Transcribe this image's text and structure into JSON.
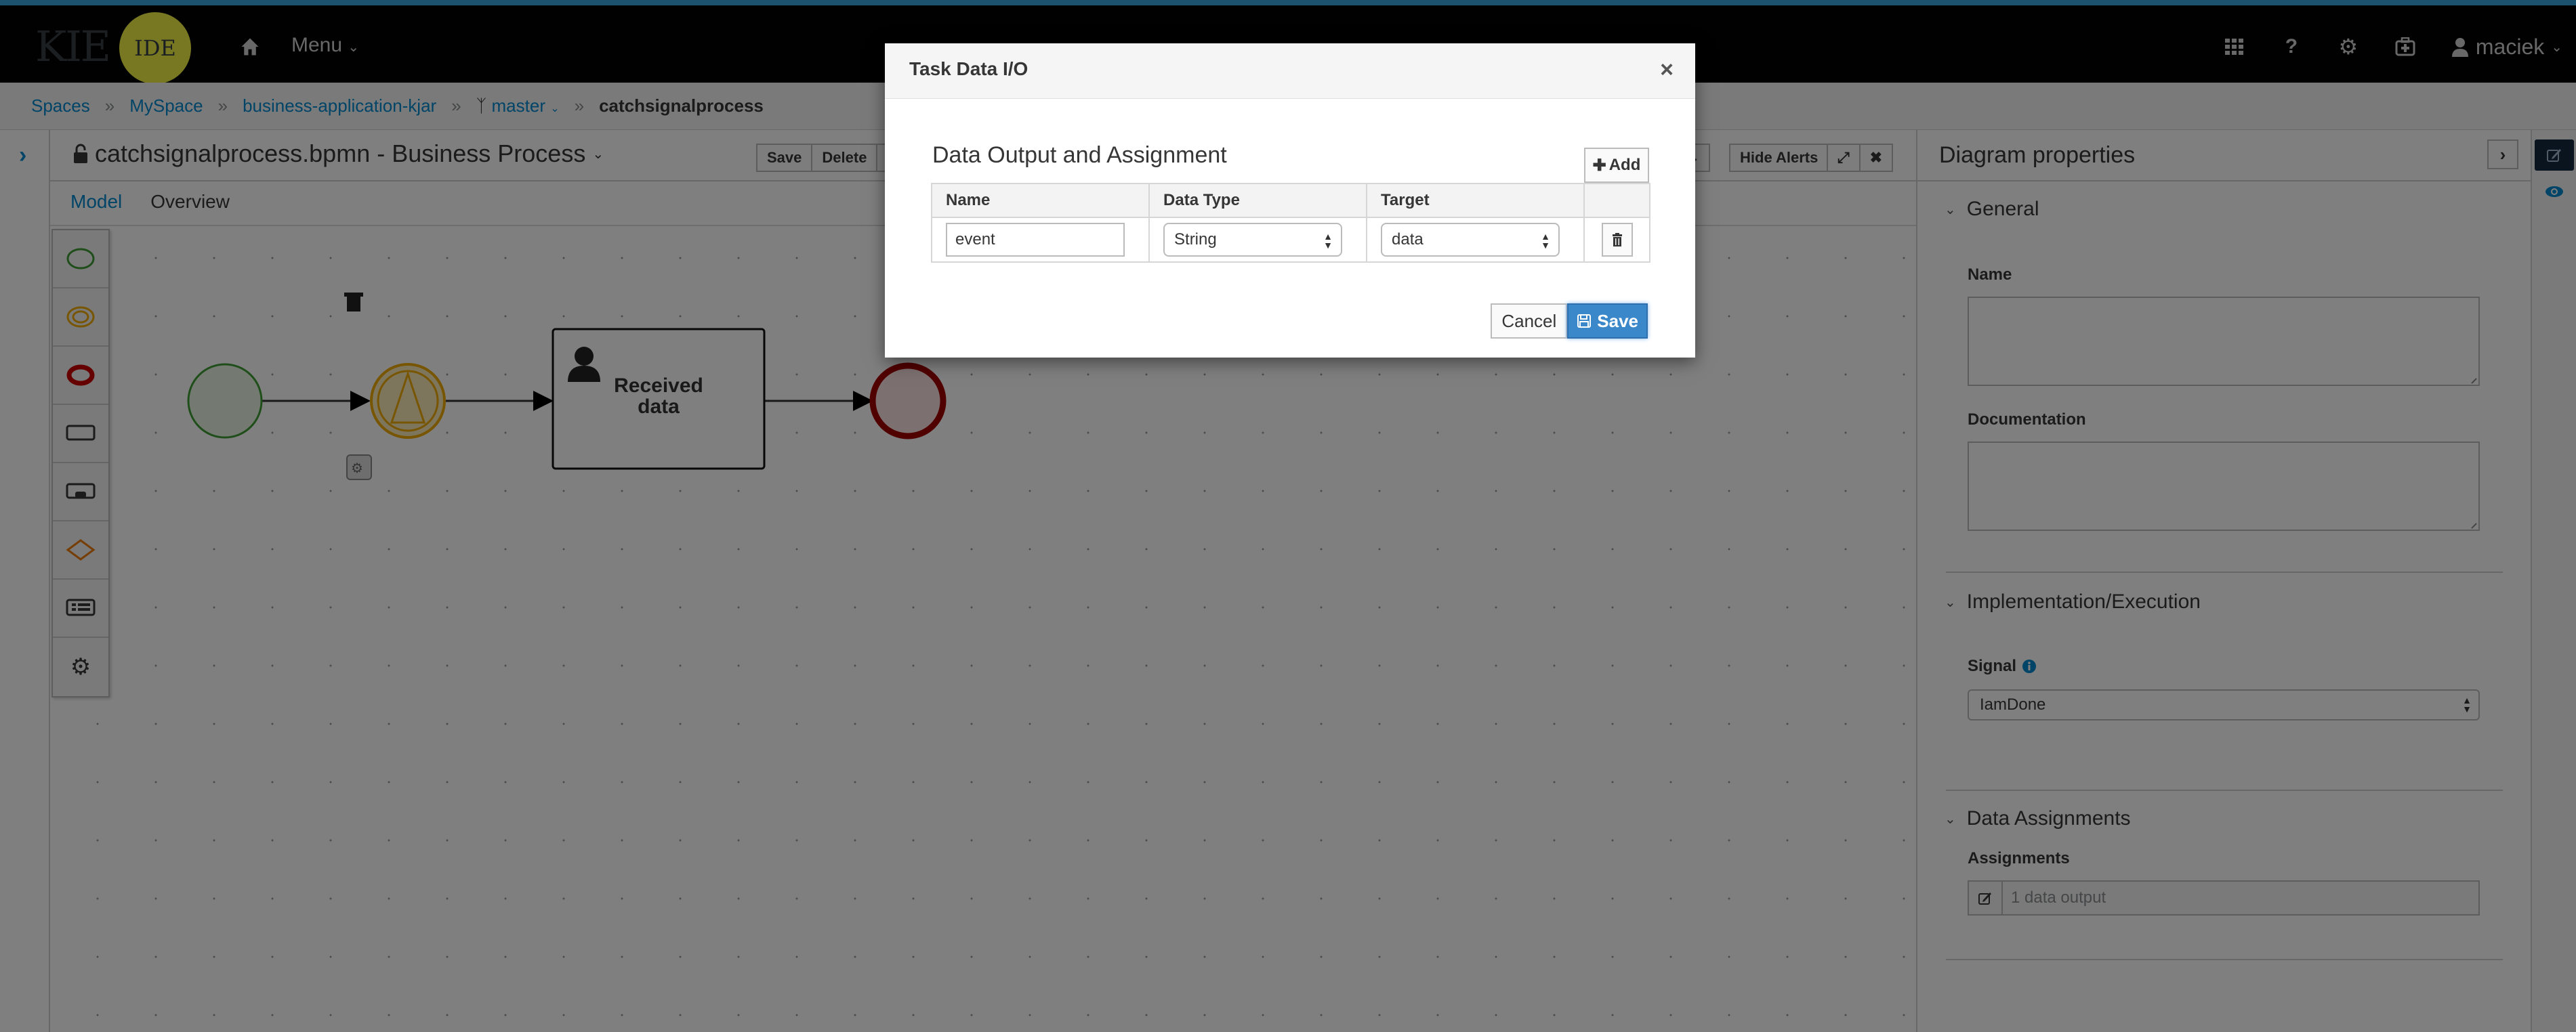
{
  "header": {
    "logo_kie": "KIE",
    "logo_ide": "IDE",
    "menu_label": "Menu",
    "user_name": "maciek",
    "icons": [
      "apps-grid-icon",
      "help-icon",
      "gear-icon",
      "medkit-icon",
      "user-icon"
    ]
  },
  "breadcrumb": {
    "items": [
      "Spaces",
      "MySpace",
      "business-application-kjar",
      "master",
      "catchsignalprocess"
    ],
    "separator": "»"
  },
  "editor": {
    "title": "catchsignalprocess.bpmn - Business Process",
    "toolbar_left": [
      "Save",
      "Delete"
    ],
    "toolbar_right": [
      "Hide Alerts"
    ],
    "tabs": [
      {
        "label": "Model",
        "active": true
      },
      {
        "label": "Overview",
        "active": false
      }
    ]
  },
  "palette": {
    "items": [
      "start-event",
      "intermediate-event",
      "end-event",
      "task",
      "subprocess",
      "gateway",
      "lane",
      "custom-tasks"
    ]
  },
  "diagram": {
    "nodes": [
      {
        "type": "start-event"
      },
      {
        "type": "intermediate-signal-catch-event"
      },
      {
        "type": "user-task",
        "label_line1": "Received",
        "label_line2": "data"
      },
      {
        "type": "end-event"
      }
    ]
  },
  "properties": {
    "title": "Diagram properties",
    "sections": {
      "general": "General",
      "implementation": "Implementation/Execution",
      "data_assignments": "Data Assignments"
    },
    "fields": {
      "name_label": "Name",
      "name_value": "",
      "documentation_label": "Documentation",
      "documentation_value": "",
      "signal_label": "Signal",
      "signal_value": "IamDone",
      "assignments_label": "Assignments",
      "assignments_value": "1 data output"
    }
  },
  "modal": {
    "title": "Task Data I/O",
    "close_glyph": "×",
    "section_title": "Data Output and Assignment",
    "add_label": "Add",
    "columns": [
      "Name",
      "Data Type",
      "Target"
    ],
    "rows": [
      {
        "name": "event",
        "data_type": "String",
        "target": "data"
      }
    ],
    "cancel_label": "Cancel",
    "save_label": "Save"
  },
  "colors": {
    "accent": "#0088ce",
    "primary_button": "#3a87c9",
    "start_event": "#3f9c35",
    "intermediate_event": "#ec7a08",
    "end_event": "#a30000",
    "signal_event": "#f0ab00"
  }
}
